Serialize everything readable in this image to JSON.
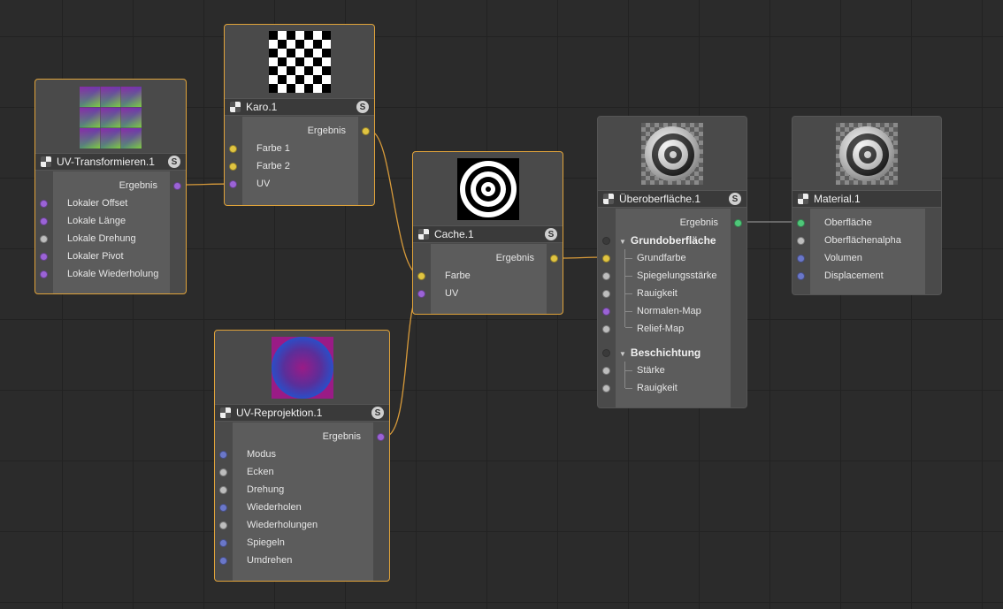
{
  "nodes": {
    "uv_transform": {
      "title": "UV-Transformieren.1",
      "output": "Ergebnis",
      "inputs": [
        "Lokaler Offset",
        "Lokale Länge",
        "Lokale Drehung",
        "Lokaler Pivot",
        "Lokale Wiederholung"
      ]
    },
    "karo": {
      "title": "Karo.1",
      "output": "Ergebnis",
      "inputs": [
        "Farbe 1",
        "Farbe 2",
        "UV"
      ]
    },
    "cache": {
      "title": "Cache.1",
      "output": "Ergebnis",
      "inputs": [
        "Farbe",
        "UV"
      ]
    },
    "uv_reproj": {
      "title": "UV-Reprojektion.1",
      "output": "Ergebnis",
      "inputs": [
        "Modus",
        "Ecken",
        "Drehung",
        "Wiederholen",
        "Wiederholungen",
        "Spiegeln",
        "Umdrehen"
      ]
    },
    "ueberoberflaeche": {
      "title": "Überoberfläche.1",
      "output": "Ergebnis",
      "group1": "Grundoberfläche",
      "group1_items": [
        "Grundfarbe",
        "Spiegelungsstärke",
        "Rauigkeit",
        "Normalen-Map",
        "Relief-Map"
      ],
      "group2": "Beschichtung",
      "group2_items": [
        "Stärke",
        "Rauigkeit"
      ]
    },
    "material": {
      "title": "Material.1",
      "inputs": [
        "Oberfläche",
        "Oberflächenalpha",
        "Volumen",
        "Displacement"
      ]
    }
  },
  "badge": "S",
  "colors": {
    "selection": "#e0a33a",
    "wire": "#d79a3a",
    "wire_gray": "#8c8c8c",
    "port_yellow": "#e0c441",
    "port_purple": "#9b63d6",
    "port_gray": "#bdbdbd",
    "port_blue": "#6a77c9",
    "port_green": "#4fc779"
  }
}
